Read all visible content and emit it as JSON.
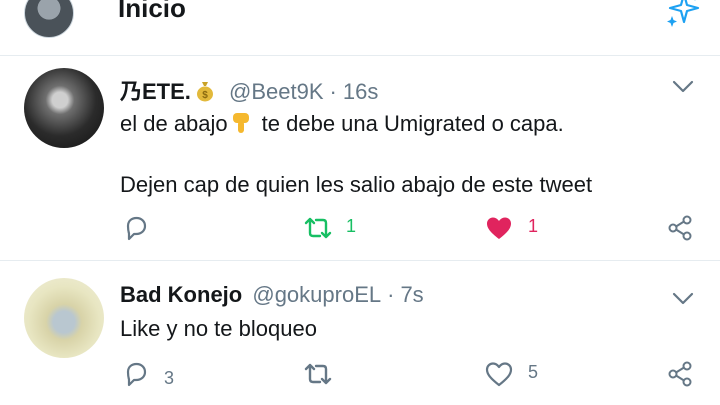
{
  "header": {
    "title": "Inicio",
    "sparkle_icon": "sparkle-icon"
  },
  "tweets": [
    {
      "display_name": "乃ETE.",
      "name_emoji": "money-bag-icon",
      "handle": "@Beet9K",
      "separator": "·",
      "time": "16s",
      "text_line1_before": "el de abajo",
      "text_emoji": "pointing-down-icon",
      "text_line1_after": "te debe una Umigrated o capa.",
      "text_line2": "Dejen cap de quien les salio abajo de este tweet",
      "replies": "",
      "retweets": "1",
      "likes": "1",
      "liked": true,
      "retweeted": true
    },
    {
      "display_name": "Bad Konejo",
      "handle": "@gokuproEL",
      "separator": "·",
      "time": "7s",
      "text_line1": "Like y no te bloqueo",
      "replies": "3",
      "retweets": "",
      "likes": "5",
      "liked": false,
      "retweeted": false
    }
  ],
  "colors": {
    "accent": "#1da1f2",
    "retweet": "#17bf63",
    "like": "#e0245e",
    "muted": "#657786",
    "divider": "#e6ecf0"
  }
}
